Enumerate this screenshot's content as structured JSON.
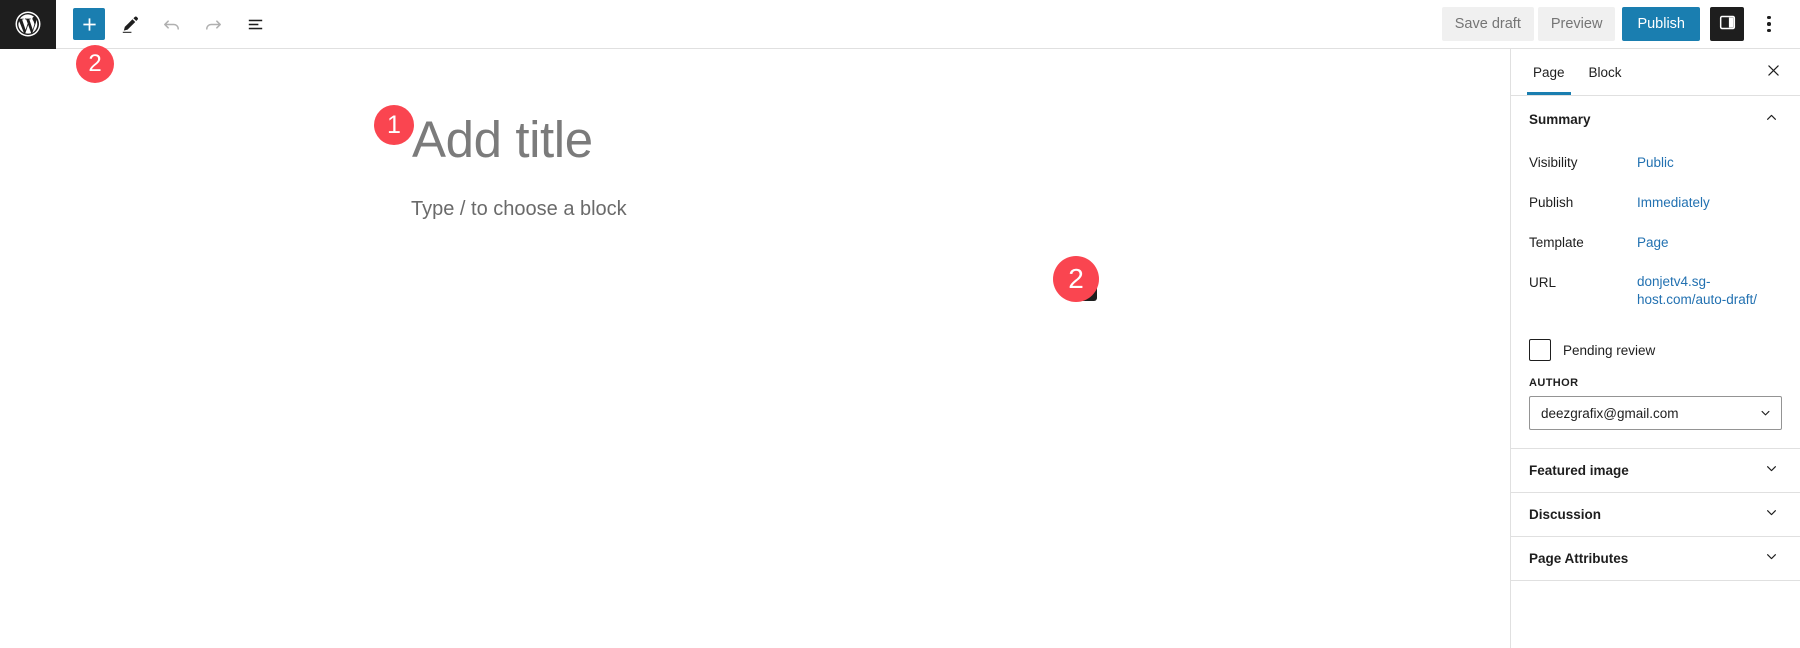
{
  "header": {
    "logo_icon": "wordpress-logo-icon",
    "tools": [
      {
        "name": "block-inserter",
        "icon": "plus-icon",
        "label": "Toggle block inserter"
      },
      {
        "name": "tools-mode",
        "icon": "pencil-icon",
        "label": "Tools"
      },
      {
        "name": "undo",
        "icon": "undo-arrow-icon",
        "label": "Undo"
      },
      {
        "name": "redo",
        "icon": "redo-arrow-icon",
        "label": "Redo"
      },
      {
        "name": "list-view",
        "icon": "list-view-icon",
        "label": "Document Overview"
      }
    ],
    "save_draft_label": "Save draft",
    "preview_label": "Preview",
    "publish_label": "Publish",
    "sidebar_toggle_icon": "sidebar-panel-icon",
    "options_icon": "kebab-menu-icon",
    "accent_blue": "#1a7eb0"
  },
  "editor": {
    "title_placeholder": "Add title",
    "block_placeholder": "Type / to choose a block",
    "inline_inserter_icon": "plus-icon"
  },
  "annotations": {
    "badge_color": "#fa4550",
    "items": [
      {
        "id": "badge-title",
        "number": "1"
      },
      {
        "id": "badge-toolbar-inserter",
        "number": "2"
      },
      {
        "id": "badge-inline-inserter",
        "number": "2"
      }
    ]
  },
  "sidebar": {
    "tabs": [
      {
        "label": "Page",
        "active": true
      },
      {
        "label": "Block",
        "active": false
      }
    ],
    "close_icon": "close-x-icon",
    "summary": {
      "title": "Summary",
      "collapse_icon": "chevron-up-icon",
      "rows": [
        {
          "label": "Visibility",
          "value": "Public"
        },
        {
          "label": "Publish",
          "value": "Immediately"
        },
        {
          "label": "Template",
          "value": "Page"
        },
        {
          "label": "URL",
          "value": "donjetv4.sg-host.com/auto-draft/"
        }
      ],
      "pending_review_label": "Pending review",
      "pending_review_checked": false,
      "author_caption": "AUTHOR",
      "author_value": "deezgrafix@gmail.com",
      "author_chevron_icon": "chevron-down-icon"
    },
    "panels": [
      {
        "label": "Featured image",
        "icon": "chevron-down-icon"
      },
      {
        "label": "Discussion",
        "icon": "chevron-down-icon"
      },
      {
        "label": "Page Attributes",
        "icon": "chevron-down-icon"
      }
    ]
  }
}
